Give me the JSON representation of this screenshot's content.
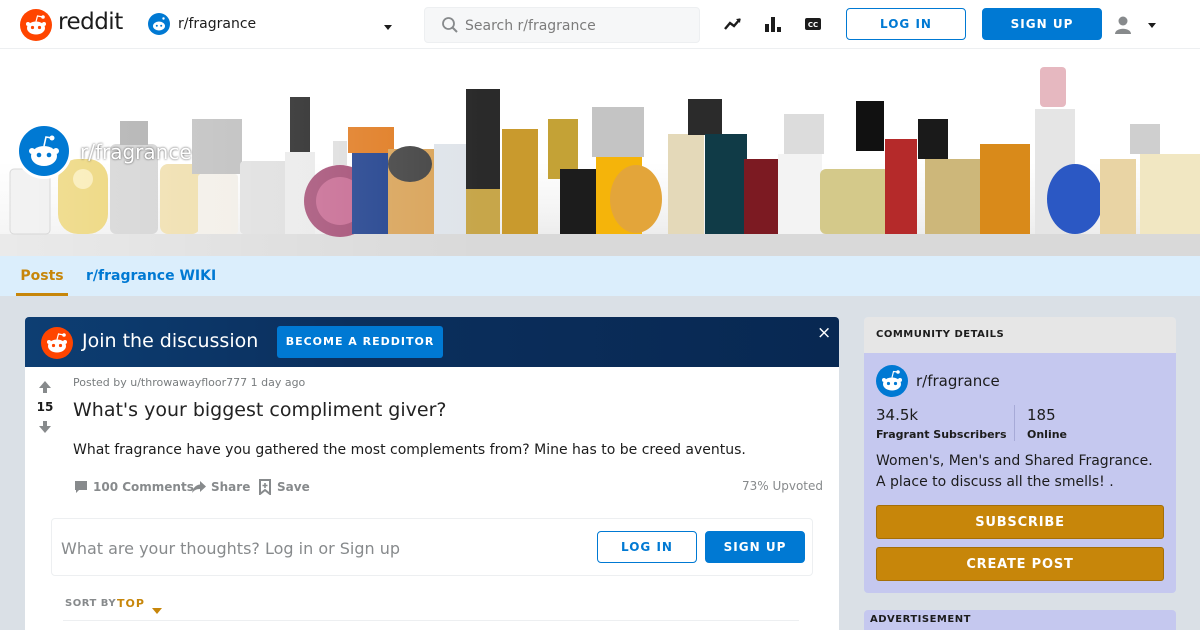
{
  "header": {
    "logo_text": "reddit",
    "subreddit": "r/fragrance",
    "search_placeholder": "Search r/fragrance",
    "login_label": "LOG IN",
    "signup_label": "SIGN UP"
  },
  "community": {
    "banner_title": "r/fragrance"
  },
  "nav": {
    "tabs": [
      {
        "label": "Posts"
      },
      {
        "label": "r/fragrance WIKI"
      }
    ]
  },
  "join_bar": {
    "text": "Join the discussion",
    "button_label": "BECOME A REDDITOR",
    "close_glyph": "×"
  },
  "post": {
    "meta": "Posted by u/throwawayfloor777 1 day ago",
    "score": "15",
    "title": "What's your biggest compliment giver?",
    "body": "What fragrance have you gathered the most complements from? Mine has to be creed aventus.",
    "comments_label": "100 Comments",
    "share_label": "Share",
    "save_label": "Save",
    "upvoted": "73% Upvoted"
  },
  "comment_box": {
    "prompt": "What are your thoughts? Log in or Sign up",
    "login_label": "LOG IN",
    "signup_label": "SIGN UP"
  },
  "sort": {
    "label": "SORT BY",
    "value": "TOP"
  },
  "sidebar": {
    "header": "COMMUNITY DETAILS",
    "name": "r/fragrance",
    "subscribers": "34.5k",
    "subscribers_label": "Fragrant Subscribers",
    "online": "185",
    "online_label": "Online",
    "description": "Women's, Men's and Shared Fragrance. A place to discuss all the smells! .",
    "subscribe_label": "SUBSCRIBE",
    "create_post_label": "CREATE POST"
  },
  "ad": {
    "label": "ADVERTISEMENT"
  },
  "colors": {
    "reddit_orange": "#ff4500",
    "blue": "#0079d3",
    "gold": "#c7860a",
    "sidebar_bg": "#c5c8ef"
  },
  "icons": [
    "reddit-logo-icon",
    "snoo-icon",
    "chevron-down-icon",
    "search-icon",
    "trending-icon",
    "stats-icon",
    "captions-icon",
    "user-icon",
    "close-icon",
    "upvote-icon",
    "downvote-icon",
    "comment-icon",
    "share-icon",
    "save-icon"
  ]
}
